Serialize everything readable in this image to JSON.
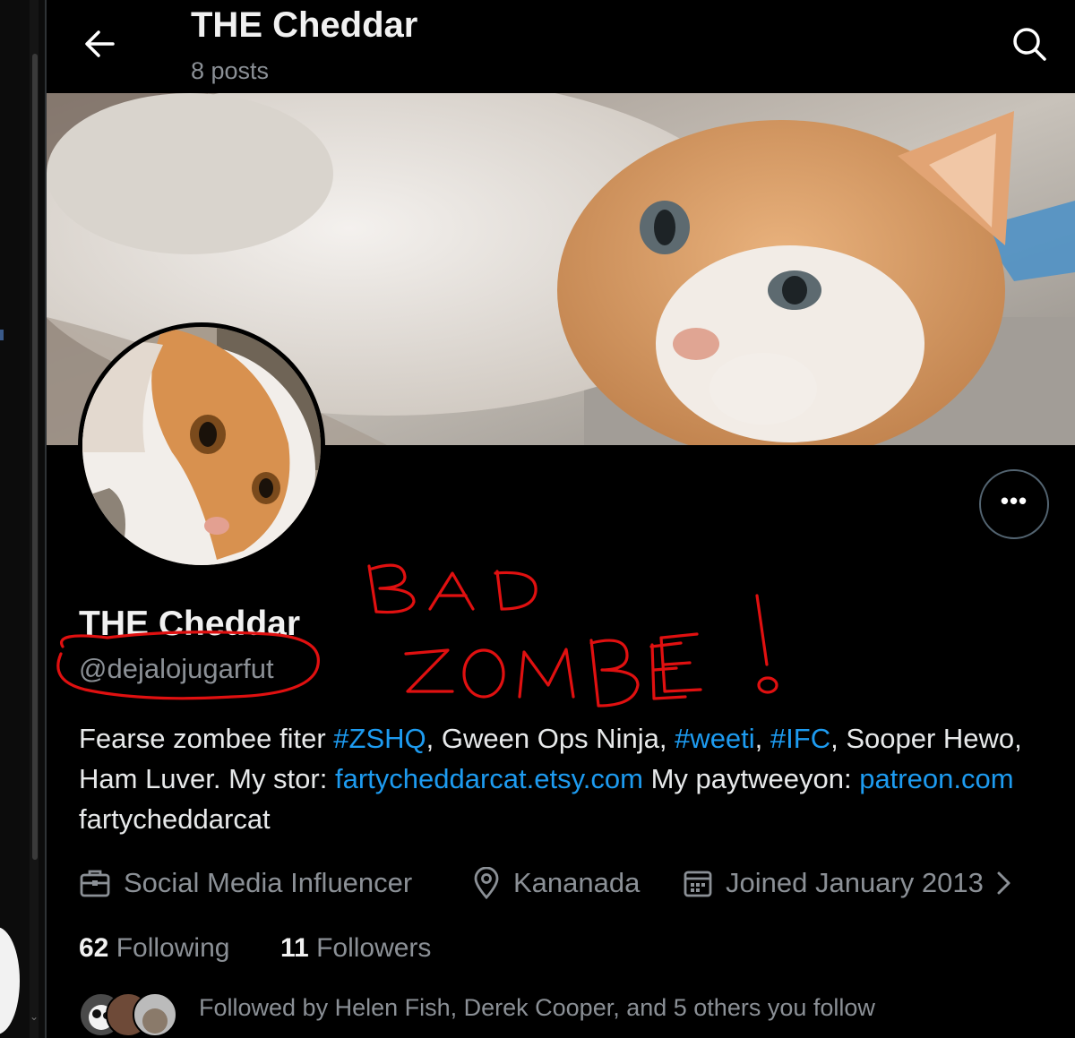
{
  "header": {
    "title": "THE Cheddar",
    "post_count": "8 posts"
  },
  "profile": {
    "display_name": "THE Cheddar",
    "handle": "@dejalojugarfut",
    "bio": {
      "t1": "Fearse zombee fiter ",
      "l1": "#ZSHQ",
      "t2": ", Gween Ops Ninja, ",
      "l2": "#weeti",
      "t3": ", ",
      "l3": "#IFC",
      "t4": ", Sooper Hewo, Ham Luver. My stor: ",
      "l4": "fartycheddarcat.etsy.com",
      "t5": " My paytweeyon: ",
      "l5": "patreon.com",
      "t6": " fartycheddarcat"
    },
    "profession": "Social Media Influencer",
    "location": "Kananada",
    "joined": "Joined January 2013",
    "following_count": "62",
    "following_label": "Following",
    "followers_count": "11",
    "followers_label": "Followers",
    "followed_by": "Followed by Helen Fish, Derek Cooper, and 5 others you follow"
  },
  "annotation": {
    "line1": "BAD",
    "line2": "ZOMBEE!"
  },
  "colors": {
    "background": "#000000",
    "link": "#1d9bf0",
    "secondary_text": "#8b9096",
    "annotation": "#e01010"
  },
  "icons": [
    "back-arrow-icon",
    "search-icon",
    "more-icon",
    "briefcase-icon",
    "location-pin-icon",
    "calendar-icon",
    "chevron-right-icon"
  ]
}
